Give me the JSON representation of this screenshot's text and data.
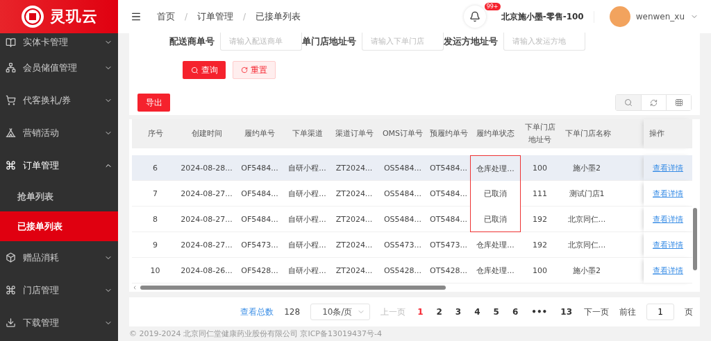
{
  "logo": {
    "text": "灵玑云"
  },
  "sidebar": {
    "items": [
      {
        "label": "实体卡管理",
        "expanded": false
      },
      {
        "label": "会员储值管理",
        "expanded": false
      },
      {
        "label": "代客换礼/券",
        "expanded": false
      },
      {
        "label": "营销活动",
        "expanded": false
      },
      {
        "label": "订单管理",
        "expanded": true,
        "children": [
          {
            "label": "抢单列表",
            "selected": false
          },
          {
            "label": "已接单列表",
            "selected": true
          }
        ]
      },
      {
        "label": "赠品消耗",
        "expanded": false
      },
      {
        "label": "门店管理",
        "expanded": false
      },
      {
        "label": "下载管理",
        "expanded": false
      }
    ]
  },
  "breadcrumb": [
    {
      "label": "首页"
    },
    {
      "separator": "/",
      "label": "订单管理"
    },
    {
      "separator": "/",
      "label": "已接单列表"
    }
  ],
  "header": {
    "badge": "99+",
    "store": "北京施小墨-零售-100",
    "user": "wenwen_xu"
  },
  "filters": [
    {
      "label": "配送商单号",
      "placeholder": "请输入配送商单"
    },
    {
      "label": "单门店地址号",
      "placeholder": "请输入下单门店"
    },
    {
      "label": "发运方地址号",
      "placeholder": "请输入发运方地"
    }
  ],
  "buttons": {
    "query": "查询",
    "reset": "重置",
    "export": "导出"
  },
  "table": {
    "columns": [
      "序号",
      "创建时间",
      "履约单号",
      "下单渠道",
      "渠道订单号",
      "OMS订单号",
      "预履约单号",
      "履约单状态",
      "下单门店地址号",
      "下单门店名称"
    ],
    "action_column": "操作",
    "rows": [
      {
        "cells": [
          "6",
          "2024-08-28...",
          "OF5484...",
          "自研小程...",
          "ZT2024...",
          "OS5484...",
          "OT5484...",
          "仓库处理...",
          "100",
          "施小墨2"
        ],
        "action": "查看详情",
        "highlighted": true,
        "flagged": true
      },
      {
        "cells": [
          "7",
          "2024-08-27...",
          "OF5484...",
          "自研小程...",
          "ZT2024...",
          "OS5484...",
          "OT5484...",
          "已取消",
          "111",
          "测试门店1"
        ],
        "action": "查看详情",
        "highlighted": false,
        "flagged": true
      },
      {
        "cells": [
          "8",
          "2024-08-27...",
          "OF5484...",
          "自研小程...",
          "ZT2024...",
          "OS5484...",
          "OT5484...",
          "已取消",
          "192",
          "北京同仁..."
        ],
        "action": "查看详情",
        "highlighted": false,
        "flagged": true
      },
      {
        "cells": [
          "9",
          "2024-08-27...",
          "OF5473...",
          "自研小程...",
          "ZT2024...",
          "OS5473...",
          "OT5473...",
          "仓库处理...",
          "192",
          "北京同仁..."
        ],
        "action": "查看详情",
        "highlighted": false,
        "flagged": false
      },
      {
        "cells": [
          "10",
          "2024-08-26...",
          "OF5428...",
          "自研小程...",
          "ZT2024...",
          "OS5428...",
          "OT5428...",
          "仓库处理...",
          "100",
          "施小墨2"
        ],
        "action": "查看详情",
        "highlighted": false,
        "flagged": false
      }
    ]
  },
  "pagination": {
    "total_label": "查看总数",
    "total": "128",
    "page_size": "10条/页",
    "prev": "上一页",
    "prev_disabled": true,
    "pages": [
      {
        "label": "1",
        "selected": true
      },
      {
        "label": "2",
        "selected": false
      },
      {
        "label": "3",
        "selected": false
      },
      {
        "label": "4",
        "selected": false
      },
      {
        "label": "5",
        "selected": false
      },
      {
        "label": "6",
        "selected": false
      },
      {
        "label": "•••",
        "selected": false
      },
      {
        "label": "13",
        "selected": false
      }
    ],
    "next": "下一页",
    "goto": "前往",
    "goto_value": "1",
    "page_unit": "页"
  },
  "footer": "© 2019-2024 北京同仁堂健康药业股份有限公司 京ICP备13019437号-4"
}
